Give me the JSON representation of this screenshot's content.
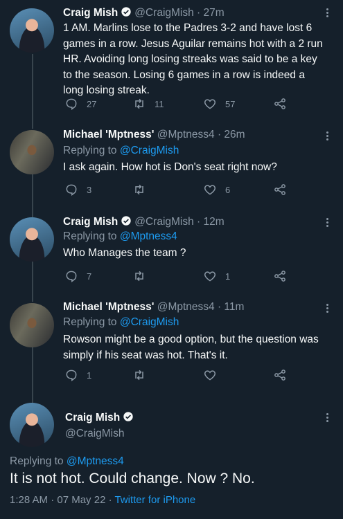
{
  "tweets": [
    {
      "name": "Craig Mish",
      "handle": "@CraigMish",
      "time": "· 27m",
      "verified": true,
      "text": "1 AM. Marlins lose to the Padres 3-2 and have lost 6 games in a row. Jesus Aguilar remains hot with a 2 run HR. Avoiding long losing streaks was said to be a key to the season. Losing 6 games in a row is indeed a long losing streak.",
      "replies": "27",
      "retweets": "11",
      "likes": "57"
    },
    {
      "name": "Michael 'Mptness'",
      "handle": "@Mptness4",
      "time": "· 26m",
      "verified": false,
      "replying_prefix": "Replying to ",
      "replying_to": "@CraigMish",
      "text": "I ask again. How hot is Don's seat right now?",
      "replies": "3",
      "retweets": "",
      "likes": "6"
    },
    {
      "name": "Craig Mish",
      "handle": "@CraigMish",
      "time": "· 12m",
      "verified": true,
      "replying_prefix": "Replying to ",
      "replying_to": "@Mptness4",
      "text": "Who Manages the team ?",
      "replies": "7",
      "retweets": "",
      "likes": "1"
    },
    {
      "name": "Michael 'Mptness'",
      "handle": "@Mptness4",
      "time": "· 11m",
      "verified": false,
      "replying_prefix": "Replying to ",
      "replying_to": "@CraigMish",
      "text": "Rowson might be a good option, but the question was simply if his seat was hot. That's it.",
      "replies": "1",
      "retweets": "",
      "likes": ""
    }
  ],
  "main_tweet": {
    "name": "Craig Mish",
    "handle": "@CraigMish",
    "replying_prefix": "Replying to ",
    "replying_to": "@Mptness4",
    "text": "It is not hot. Could change. Now ? No.",
    "time": "1:28 AM · 07 May 22 · ",
    "source": "Twitter for iPhone"
  },
  "colors": {
    "accent": "#1d9bf0",
    "background": "#15202b",
    "muted": "#8b98a5"
  },
  "icons": [
    "reply-icon",
    "retweet-icon",
    "like-icon",
    "share-icon",
    "verified-badge-icon",
    "more-icon"
  ]
}
